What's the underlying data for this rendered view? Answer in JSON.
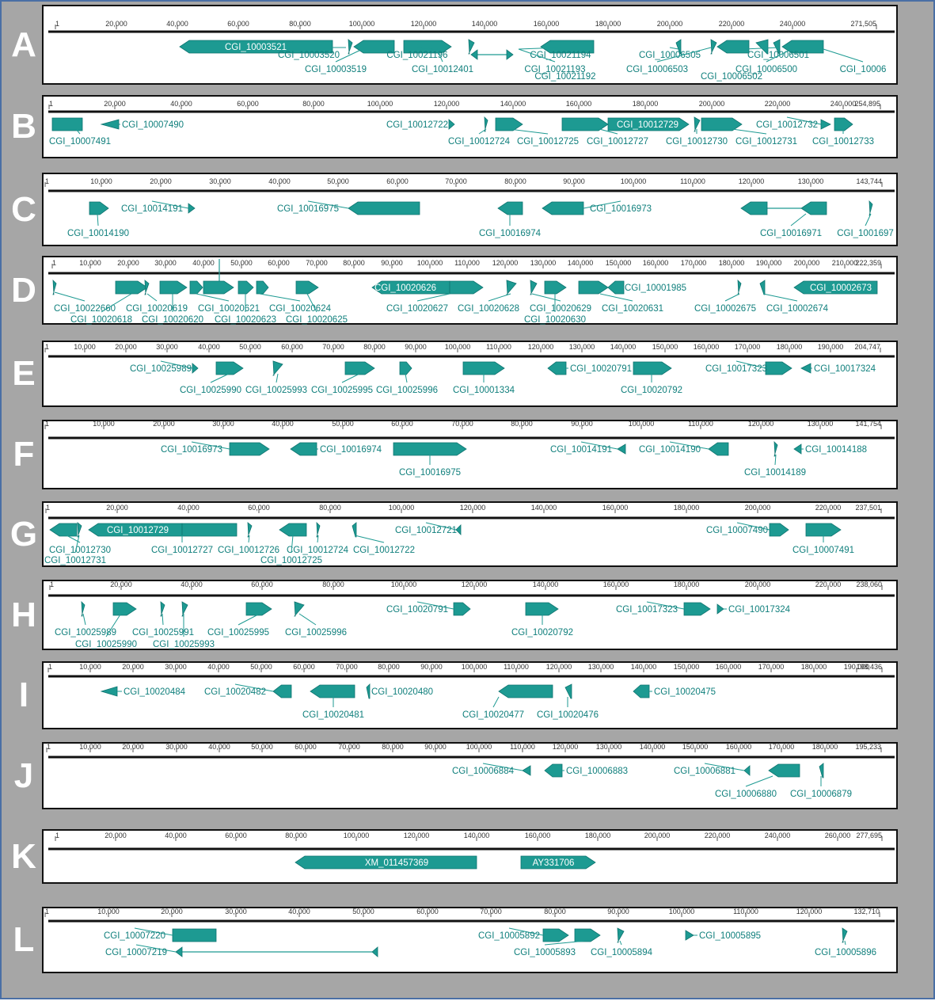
{
  "colors": {
    "gene": "#1d9a92",
    "gene_edge": "#0e7470",
    "label": "#0f7f7c",
    "axis": "#111111",
    "background": "#a6a6a6"
  },
  "lanes": [
    {
      "letter": "A",
      "ticks": [
        "1",
        "20,000",
        "40,000",
        "60,000",
        "80,000",
        "100,000",
        "120,000",
        "140,000",
        "160,000",
        "180,000",
        "200,000",
        "220,000",
        "240,000",
        "271,505"
      ],
      "labels": [
        "CGI_10003521",
        "CGI_10003520",
        "CGI_10003519",
        "CGI_10021196",
        "CGI_10012401",
        "CGI_10021194",
        "CGI_10021193",
        "CGI_10021192",
        "CGI_10006505",
        "CGI_10006503",
        "CGI_10006501",
        "CGI_10006500",
        "CGI_10006502",
        "CGI_10006"
      ]
    },
    {
      "letter": "B",
      "ticks": [
        "1",
        "20,000",
        "40,000",
        "60,000",
        "80,000",
        "100,000",
        "120,000",
        "140,000",
        "160,000",
        "180,000",
        "200,000",
        "220,000",
        "240,000",
        "254,895"
      ],
      "labels": [
        "CGI_10007491",
        "CGI_10007490",
        "CGI_10012722",
        "CGI_10012724",
        "CGI_10012725",
        "CGI_10012727",
        "CGI_10012729",
        "CGI_10012730",
        "CGI_10012731",
        "CGI_10012732",
        "CGI_10012733"
      ]
    },
    {
      "letter": "C",
      "ticks": [
        "1",
        "10,000",
        "20,000",
        "30,000",
        "40,000",
        "50,000",
        "60,000",
        "70,000",
        "80,000",
        "90,000",
        "100,000",
        "110,000",
        "120,000",
        "130,000",
        "143,744"
      ],
      "labels": [
        "CGI_10014190",
        "CGI_10014191",
        "CGI_10016975",
        "CGI_10016974",
        "CGI_10016973",
        "CGI_10016971",
        "CGI_1001697"
      ]
    },
    {
      "letter": "D",
      "ticks": [
        "1",
        "10,000",
        "20,000",
        "30,000",
        "40,000",
        "50,000",
        "60,000",
        "70,000",
        "80,000",
        "90,000",
        "100,000",
        "110,000",
        "120,000",
        "130,000",
        "140,000",
        "150,000",
        "160,000",
        "170,000",
        "180,000",
        "190,000",
        "200,000",
        "210,000",
        "222,359"
      ],
      "labels": [
        "CGI_10022660",
        "CGI_10020618",
        "CGI_10020619",
        "CGI_10020620",
        "CGI_10020621",
        "CGI_10020623",
        "CGI_10020624",
        "CGI_10020625",
        "CGI_10020626",
        "CGI_10020627",
        "CGI_10020628",
        "CGI_10020629",
        "CGI_10020630",
        "CGI_10020631",
        "CGI_10001985",
        "CGI_10002675",
        "CGI_10002674",
        "CGI_10002673"
      ]
    },
    {
      "letter": "E",
      "ticks": [
        "1",
        "10,000",
        "20,000",
        "30,000",
        "40,000",
        "50,000",
        "60,000",
        "70,000",
        "80,000",
        "90,000",
        "100,000",
        "110,000",
        "120,000",
        "130,000",
        "140,000",
        "150,000",
        "160,000",
        "170,000",
        "180,000",
        "190,000",
        "204,747"
      ],
      "labels": [
        "CGI_10025989",
        "CGI_10025990",
        "CGI_10025993",
        "CGI_10025995",
        "CGI_10025996",
        "CGI_10001334",
        "CGI_10020791",
        "CGI_10020792",
        "CGI_10017323",
        "CGI_10017324"
      ]
    },
    {
      "letter": "F",
      "ticks": [
        "1",
        "10,000",
        "20,000",
        "30,000",
        "40,000",
        "50,000",
        "60,000",
        "70,000",
        "80,000",
        "90,000",
        "100,000",
        "110,000",
        "120,000",
        "130,000",
        "141,754"
      ],
      "labels": [
        "CGI_10016973",
        "CGI_10016974",
        "CGI_10016975",
        "CGI_10014191",
        "CGI_10014190",
        "CGI_10014189",
        "CGI_10014188"
      ]
    },
    {
      "letter": "G",
      "ticks": [
        "1",
        "20,000",
        "40,000",
        "60,000",
        "80,000",
        "100,000",
        "120,000",
        "140,000",
        "160,000",
        "180,000",
        "200,000",
        "220,000",
        "237,501"
      ],
      "labels": [
        "CGI_10012730",
        "CGI_10012731",
        "CGI_10012729",
        "CGI_10012727",
        "CGI_10012726",
        "CGI_10012724",
        "CGI_10012725",
        "CGI_10012722",
        "CGI_10012721",
        "CGI_10007490",
        "CGI_10007491"
      ]
    },
    {
      "letter": "H",
      "ticks": [
        "1",
        "20,000",
        "40,000",
        "60,000",
        "80,000",
        "100,000",
        "120,000",
        "140,000",
        "160,000",
        "180,000",
        "200,000",
        "220,000",
        "238,060"
      ],
      "labels": [
        "CGI_10025989",
        "CGI_10025990",
        "CGI_10025991",
        "CGI_10025993",
        "CGI_10025995",
        "CGI_10025996",
        "CGI_10020791",
        "CGI_10020792",
        "CGI_10017323",
        "CGI_10017324"
      ]
    },
    {
      "letter": "I",
      "ticks": [
        "1",
        "10,000",
        "20,000",
        "30,000",
        "40,000",
        "50,000",
        "60,000",
        "70,000",
        "80,000",
        "90,000",
        "100,000",
        "110,000",
        "120,000",
        "130,000",
        "140,000",
        "150,000",
        "160,000",
        "170,000",
        "180,000",
        "190,000",
        "198,436"
      ],
      "labels": [
        "CGI_10020484",
        "CGI_10020482",
        "CGI_10020481",
        "CGI_10020480",
        "CGI_10020477",
        "CGI_10020476",
        "CGI_10020475"
      ]
    },
    {
      "letter": "J",
      "ticks": [
        "1",
        "10,000",
        "20,000",
        "30,000",
        "40,000",
        "50,000",
        "60,000",
        "70,000",
        "80,000",
        "90,000",
        "100,000",
        "110,000",
        "120,000",
        "130,000",
        "140,000",
        "150,000",
        "160,000",
        "170,000",
        "180,000",
        "195,233"
      ],
      "labels": [
        "CGI_10006884",
        "CGI_10006883",
        "CGI_10006881",
        "CGI_10006880",
        "CGI_10006879"
      ]
    },
    {
      "letter": "K",
      "ticks": [
        "1",
        "20,000",
        "40,000",
        "60,000",
        "80,000",
        "100,000",
        "120,000",
        "140,000",
        "160,000",
        "180,000",
        "200,000",
        "220,000",
        "240,000",
        "260,000",
        "277,695"
      ],
      "labels": [
        "XM_011457369",
        "AY331706"
      ]
    },
    {
      "letter": "L",
      "ticks": [
        "1",
        "10,000",
        "20,000",
        "30,000",
        "40,000",
        "50,000",
        "60,000",
        "70,000",
        "80,000",
        "90,000",
        "100,000",
        "110,000",
        "120,000",
        "132,710"
      ],
      "labels": [
        "CGI_10007220",
        "CGI_10007219",
        "CGI_10005892",
        "CGI_10005893",
        "CGI_10005894",
        "CGI_10005895",
        "CGI_10005896"
      ]
    }
  ]
}
